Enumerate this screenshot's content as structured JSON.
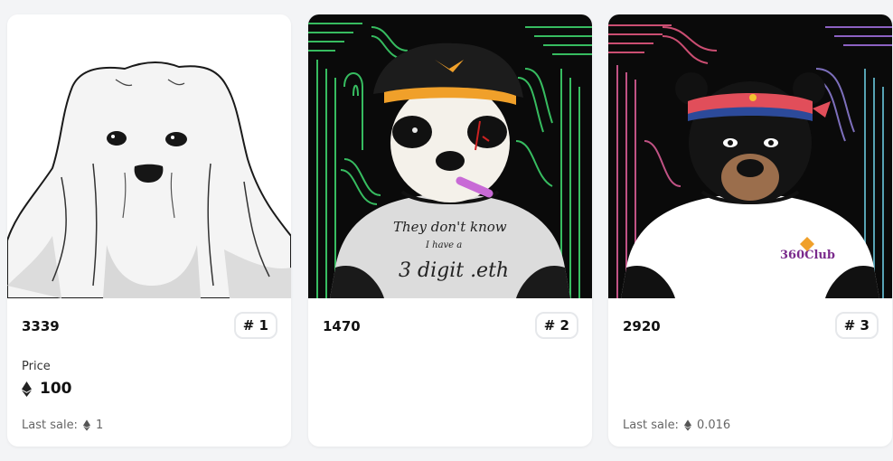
{
  "cards": [
    {
      "token_id": "3339",
      "rank": "# 1",
      "price_label": "Price",
      "price_value": "100",
      "last_sale_label": "Last sale:",
      "last_sale_value": "1",
      "art": "ghost-artwork"
    },
    {
      "token_id": "1470",
      "rank": "# 2",
      "art": "panda-pilot-artwork",
      "shirt_text": [
        "They don't know",
        "I have a",
        "3 digit .eth"
      ]
    },
    {
      "token_id": "2920",
      "rank": "# 3",
      "last_sale_label": "Last sale:",
      "last_sale_value": "0.016",
      "art": "black-bear-artwork",
      "shirt_logo": "360Club"
    }
  ],
  "colors": {
    "page_bg": "#f3f4f6",
    "card_bg": "#ffffff",
    "badge_border": "#e6e8eb",
    "green_pattern": "#3cd06a",
    "pink_pattern": "#e0567e"
  },
  "icons": [
    "ethereum-icon"
  ]
}
